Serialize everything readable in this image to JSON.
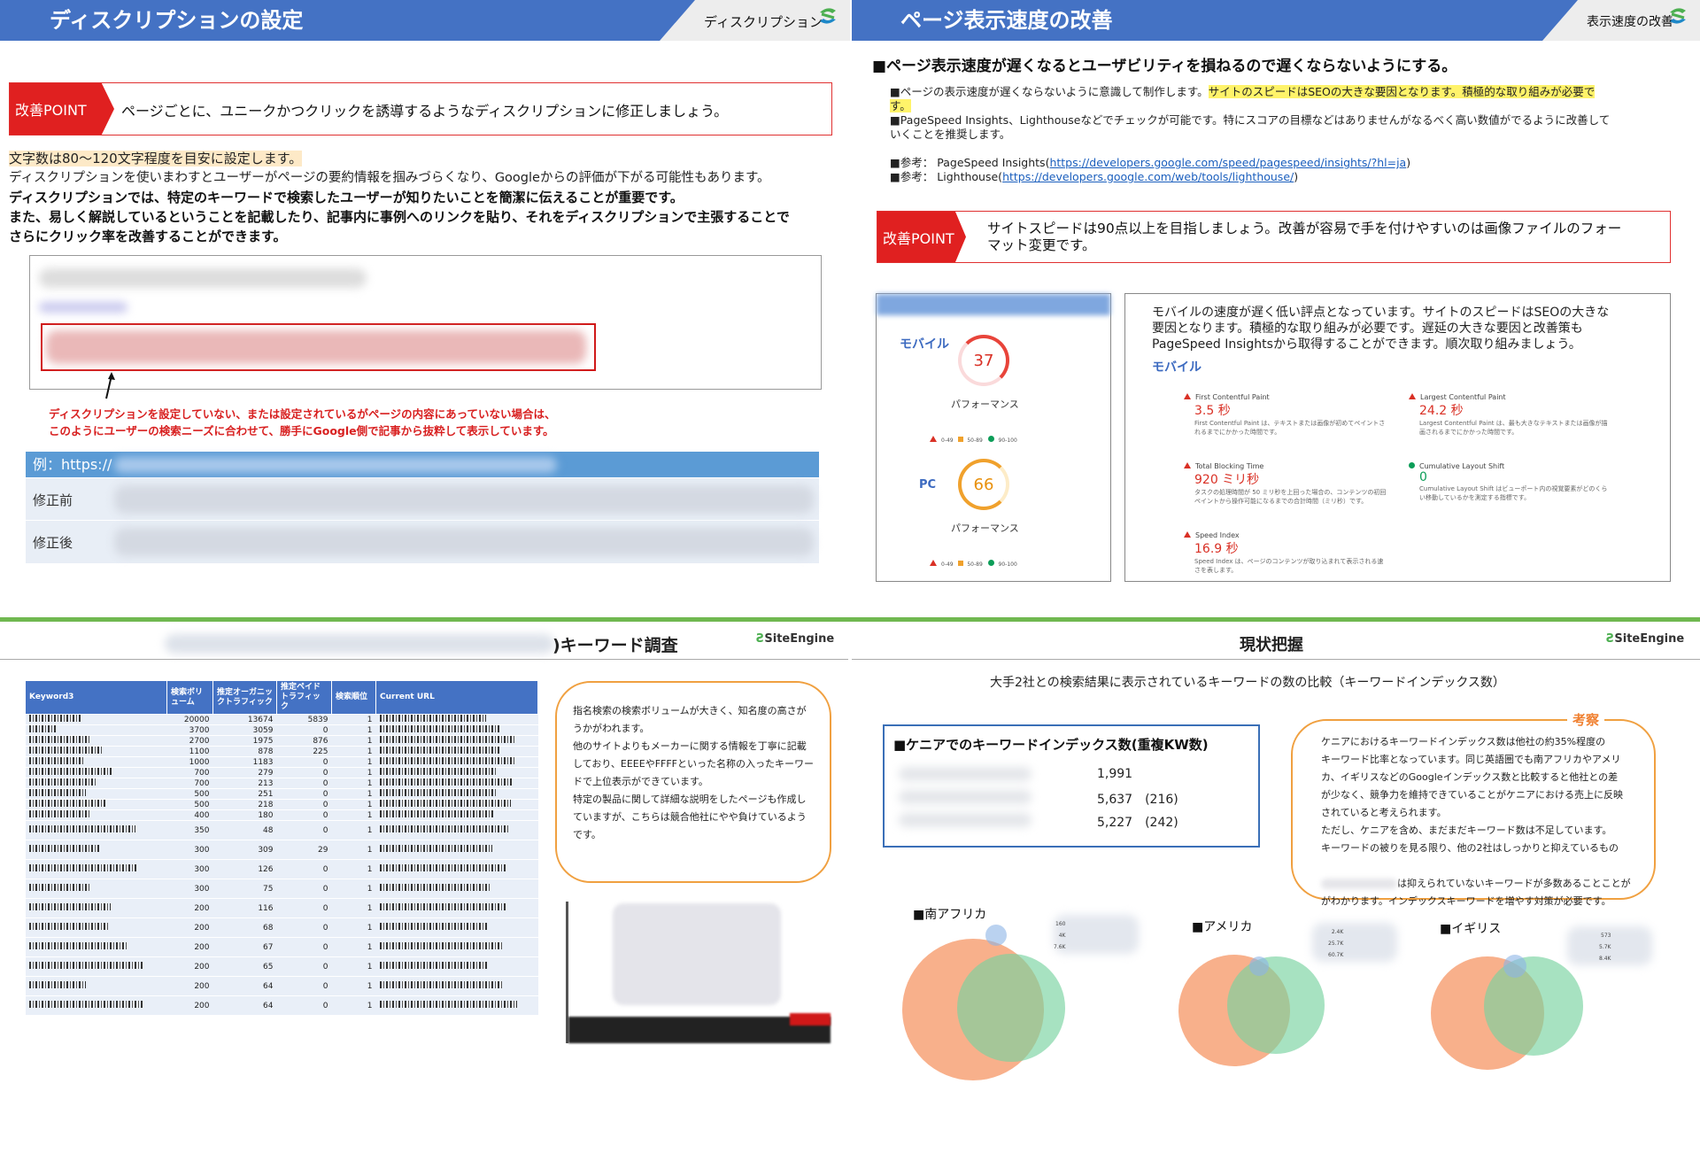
{
  "slide1": {
    "title": "ディスクリプションの設定",
    "tag": "ディスクリプション",
    "logo_small": "SiteEngine",
    "point_label": "改善POINT",
    "point_text": "ページごとに、ユニークかつクリックを誘導するようなディスクリプションに修正しましょう。",
    "line1": "文字数は80～120文字程度を目安に設定します。",
    "line2": "ディスクリプションを使いまわすとユーザーがページの要約情報を掴みづらくなり、Googleからの評価が下がる可能性もあります。",
    "line3": "ディスクリプションでは、特定のキーワードで検索したユーザーが知りたいことを簡潔に伝えることが重要です。",
    "line4a": "また、易しく解説しているということを記載したり、記事内に事例へのリンクを貼り、それをディスクリプションで主張することで",
    "line4b": "さらにクリック率を改善することができます。",
    "note1": "ディスクリプションを設定していない、または設定されているがページの内容にあっていない場合は、",
    "note2": "このようにユーザーの検索ニーズに合わせて、勝手にGoogle側で記事から抜粋して表示しています。",
    "example_label": "例：https://",
    "before_label": "修正前",
    "after_label": "修正後"
  },
  "slide2": {
    "title": "ページ表示速度の改善",
    "tag": "表示速度の改善",
    "logo_small": "SiteEngine",
    "heading": "■ページ表示速度が遅くなるとユーザビリティを損ねるので遅くならないようにする。",
    "b1a": "■ページの表示速度が遅くならないように意識して制作します。",
    "b1b": "サイトのスピードはSEOの大きな要因となります。積極的な取り組みが必要で",
    "b1c": "す。",
    "b2a": "■PageSpeed Insights、Lighthouseなどでチェックが可能です。特にスコアの目標などはありませんがなるべく高い数値がでるように改善して",
    "b2b": "いくことを推奨します。",
    "ref1_label": "■参考：  PageSpeed Insights(",
    "ref1_url": "https://developers.google.com/speed/pagespeed/insights/?hl=ja",
    "ref1_end": ")",
    "ref2_label": "■参考：  Lighthouse(",
    "ref2_url": "https://developers.google.com/web/tools/lighthouse/",
    "ref2_end": ")",
    "point_label": "改善POINT",
    "point_text1": "サイトスピードは90点以上を目指しましょう。改善が容易で手を付けやすいのは画像ファイルのフォー",
    "point_text2": "マット変更です。",
    "mobile_label": "モバイル",
    "mobile_score": "37",
    "perf_label": "パフォーマンス",
    "pc_label": "PC",
    "pc_score": "66",
    "perf_label2": "パフォーマンス",
    "legend": [
      "0-49",
      "50-89",
      "90-100"
    ],
    "desc1": "モバイルの速度が遅く低い評点となっています。サイトのスピードはSEOの大きな",
    "desc2": "要因となります。積極的な取り組みが必要です。遅延の大きな要因と改善策も",
    "desc3": "PageSpeed Insightsから取得することができます。順次取り組みましょう。",
    "mobile_label2": "モバイル",
    "metrics": [
      {
        "title": "First Contentful Paint",
        "value": "3.5 秒",
        "desc": "First Contentful Paint は、テキストまたは画像が初めてペイントされるまでにかかった時間です。"
      },
      {
        "title": "Largest Contentful Paint",
        "value": "24.2 秒",
        "desc": "Largest Contentful Paint は、最も大きなテキストまたは画像が描画されるまでにかかった時間です。"
      },
      {
        "title": "Total Blocking Time",
        "value": "920 ミリ秒",
        "desc": "タスクの処理時間が 50 ミリ秒を上回った場合の、コンテンツの初回ペイントから操作可能になるまでの合計時間（ミリ秒）です。"
      },
      {
        "title": "Cumulative Layout Shift",
        "value": "0",
        "desc": "Cumulative Layout Shift はビューポート内の視覚要素がどのくらい移動しているかを測定する指標です。"
      },
      {
        "title": "Speed Index",
        "value": "16.9 秒",
        "desc": "Speed Index は、ページのコンテンツが取り込まれて表示される速さを表します。"
      }
    ]
  },
  "slide3": {
    "title": ")キーワード調査",
    "logo": "SiteEngine",
    "headers": [
      "Keyword3",
      "検索ボリューム",
      "推定オーガニックトラフィック",
      "推定ペイドトラフィック",
      "検索順位",
      "Current URL"
    ],
    "rows": [
      [
        "20000",
        "13674",
        "5839",
        "1"
      ],
      [
        "3700",
        "3059",
        "0",
        "1"
      ],
      [
        "2700",
        "1975",
        "876",
        "1"
      ],
      [
        "1100",
        "878",
        "225",
        "1"
      ],
      [
        "1000",
        "1183",
        "0",
        "1"
      ],
      [
        "700",
        "279",
        "0",
        "1"
      ],
      [
        "700",
        "213",
        "0",
        "1"
      ],
      [
        "500",
        "251",
        "0",
        "1"
      ],
      [
        "500",
        "218",
        "0",
        "1"
      ],
      [
        "400",
        "180",
        "0",
        "1"
      ],
      [
        "350",
        "48",
        "0",
        "1"
      ],
      [
        "300",
        "309",
        "29",
        "1"
      ],
      [
        "300",
        "126",
        "0",
        "1"
      ],
      [
        "300",
        "75",
        "0",
        "1"
      ],
      [
        "200",
        "116",
        "0",
        "1"
      ],
      [
        "200",
        "68",
        "0",
        "1"
      ],
      [
        "200",
        "67",
        "0",
        "1"
      ],
      [
        "200",
        "65",
        "0",
        "1"
      ],
      [
        "200",
        "64",
        "0",
        "1"
      ],
      [
        "200",
        "64",
        "0",
        "1"
      ]
    ],
    "comment": [
      "指名検索の検索ボリュームが大きく、知名度の高さが",
      "うかがわれます。",
      "他のサイトよりもメーカーに関する情報を丁寧に記載",
      "しており、EEEEやFFFFといった名称の入ったキーワー",
      "ドで上位表示ができています。",
      "特定の製品に関して詳細な説明をしたページも作成し",
      "ていますが、こちらは競合他社にやや負けているよう",
      "です。"
    ]
  },
  "slide4": {
    "title": "現状把握",
    "logo": "SiteEngine",
    "subtitle": "大手2社との検索結果に表示されているキーワードの数の比較（キーワードインデックス数）",
    "box_title": "■ケニアでのキーワードインデックス数(重複KW数)",
    "values": [
      "1,991",
      "5,637　(216)",
      "5,227　(242)"
    ],
    "insight_label": "考察",
    "insight": [
      "ケニアにおけるキーワードインデックス数は他社の約35%程度の",
      "キーワード比率となっています。同じ英語圏でも南アフリカやアメリ",
      "カ、イギリスなどのGoogleインデックス数と比較すると他社との差",
      "が少なく、競争力を維持できていることがケニアにおける売上に反映",
      "されていると考えられます。",
      "ただし、ケニアを含め、まだまだキーワード数は不足しています。",
      "キーワードの被りを見る限り、他の2社はしっかりと抑えているもの",
      "の、",
      "は抑えられていないキーワードが多数あることことが",
      "がわかります。インデックスキーワードを増やす対策が必要です。"
    ],
    "venns": [
      {
        "label": "■南アフリカ",
        "nums": [
          "160",
          "4K",
          "7.6K"
        ]
      },
      {
        "label": "■アメリカ",
        "nums": [
          "2.4K",
          "25.7K",
          "60.7K"
        ]
      },
      {
        "label": "■イギリス",
        "nums": [
          "573",
          "5.7K",
          "8.4K"
        ]
      }
    ]
  }
}
